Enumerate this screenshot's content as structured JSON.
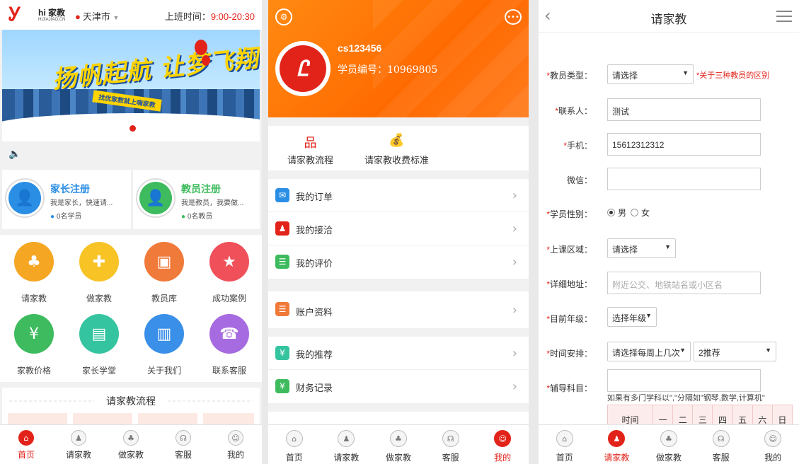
{
  "home": {
    "logo_mark": "Ꭹ",
    "logo_text": "hi 家教",
    "logo_sub": "HIJIAJIAO.CN",
    "city": "天津市",
    "hours_label": "上班时间：",
    "hours_value": "9:00-20:30",
    "banner_slogan": "扬帆起航 让梦飞翔",
    "banner_tag": "找优家教就上嗨家教",
    "parent_reg": {
      "title": "家长注册",
      "desc": "我是家长，快速请...",
      "count": "0名学员",
      "color": "#2a8ee5"
    },
    "tutor_reg": {
      "title": "教员注册",
      "desc": "我是教员，我要做...",
      "count": "0名教员",
      "color": "#3dbb5e"
    },
    "grid": [
      {
        "label": "请家教",
        "icon": "find-tutor-icon",
        "color": "#f5a623"
      },
      {
        "label": "做家教",
        "icon": "be-tutor-icon",
        "color": "#f7c325"
      },
      {
        "label": "教员库",
        "icon": "tutor-library-icon",
        "color": "#f07a3a"
      },
      {
        "label": "成功案例",
        "icon": "success-case-icon",
        "color": "#f0505a"
      },
      {
        "label": "家教价格",
        "icon": "price-icon",
        "color": "#3dbb5e"
      },
      {
        "label": "家长学堂",
        "icon": "parent-class-icon",
        "color": "#35c4a0"
      },
      {
        "label": "关于我们",
        "icon": "about-icon",
        "color": "#3a8fe8"
      },
      {
        "label": "联系客服",
        "icon": "customer-service-icon",
        "color": "#a66be0"
      }
    ],
    "flow_title": "请家教流程",
    "tabs": [
      "首页",
      "请家教",
      "做家教",
      "客服",
      "我的"
    ]
  },
  "profile": {
    "username": "cs123456",
    "student_id": "学员编号：10969805",
    "quick": [
      "请家教流程",
      "请家教收费标准"
    ],
    "menu1": [
      {
        "label": "我的订单",
        "icon": "order-icon",
        "color": "#2a8ee5"
      },
      {
        "label": "我的接洽",
        "icon": "contact-icon",
        "color": "#e2231a"
      },
      {
        "label": "我的评价",
        "icon": "review-icon",
        "color": "#3dbb5e"
      }
    ],
    "menu2": [
      {
        "label": "账户资料",
        "icon": "account-icon",
        "color": "#f07a3a"
      }
    ],
    "menu3": [
      {
        "label": "我的推荐",
        "icon": "recommend-icon",
        "color": "#35c4a0"
      },
      {
        "label": "财务记录",
        "icon": "finance-icon",
        "color": "#3dbb5e"
      }
    ],
    "tabs": [
      "首页",
      "请家教",
      "做家教",
      "客服",
      "我的"
    ]
  },
  "form": {
    "title": "请家教",
    "teacher_type_label": "教员类型：",
    "teacher_type_value": "请选择",
    "teacher_type_link": "*关于三种教员的区别",
    "contact_label": "联系人：",
    "contact_value": "测试",
    "phone_label": "手机：",
    "phone_value": "15612312312",
    "wechat_label": "微信：",
    "wechat_value": "",
    "gender_label": "学员性别：",
    "gender_male": "男",
    "gender_female": "女",
    "area_label": "上课区域：",
    "area_value": "请选择",
    "address_label": "详细地址：",
    "address_placeholder": "附近公交、地铁站名或小区名",
    "grade_label": "目前年级：",
    "grade_value": "选择年级",
    "schedule_label": "时间安排：",
    "schedule_value1": "请选择每周上几次",
    "schedule_value2": "2推荐",
    "subject_label": "辅导科目：",
    "subject_hint": "如果有多门学科以\",\"分隔如\"钢琴,数学,计算机\"",
    "table_head": [
      "时间",
      "一",
      "二",
      "三",
      "四",
      "五",
      "六",
      "日"
    ],
    "tabs": [
      "首页",
      "请家教",
      "做家教",
      "客服",
      "我的"
    ]
  }
}
